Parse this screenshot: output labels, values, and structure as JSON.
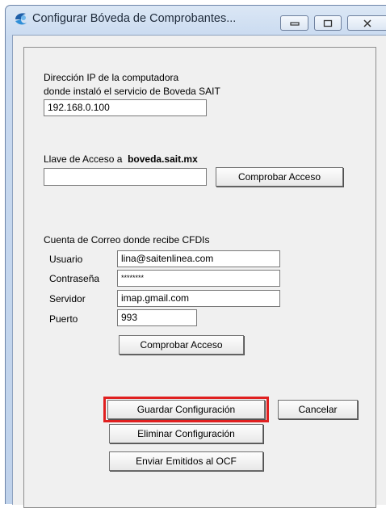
{
  "window": {
    "title": "Configurar Bóveda de Comprobantes..."
  },
  "server_section": {
    "ip_label_line1": "Dirección IP de la computadora",
    "ip_label_line2": "donde instaló el servicio de Boveda SAIT",
    "ip_value": "192.168.0.100"
  },
  "access_section": {
    "key_label": "Llave de Acceso a",
    "key_domain": "boveda.sait.mx",
    "key_value": "",
    "check_button": "Comprobar Acceso"
  },
  "mail_section": {
    "heading": "Cuenta de Correo donde recibe CFDIs",
    "user_label": "Usuario",
    "user_value": "lina@saitenlinea.com",
    "password_label": "Contraseña",
    "password_value": "********",
    "server_label": "Servidor",
    "server_value": "imap.gmail.com",
    "port_label": "Puerto",
    "port_value": "993",
    "check_button": "Comprobar Acceso"
  },
  "actions": {
    "save": "Guardar Configuración",
    "cancel": "Cancelar",
    "delete": "Eliminar Configuración",
    "send": "Enviar Emitidos al OCF"
  },
  "colors": {
    "highlight": "#e02020"
  },
  "icons": {
    "app": "sait-logo-icon",
    "minimize": "minimize-icon",
    "maximize": "maximize-icon",
    "close": "close-icon"
  }
}
